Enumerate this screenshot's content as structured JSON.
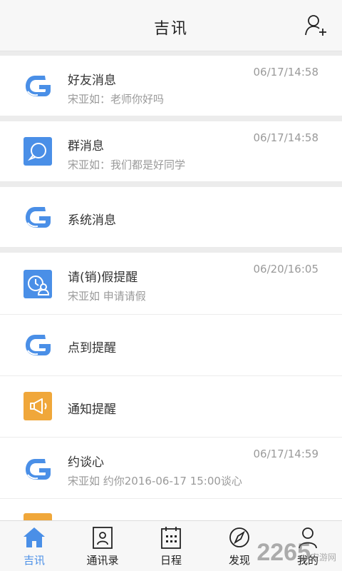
{
  "header": {
    "title": "吉讯",
    "add_icon": "add-contact-icon"
  },
  "items": [
    {
      "name": "好友消息",
      "preview": "宋亚如：老师你好吗",
      "time": "06/17/14:58",
      "icon": "app-logo-icon"
    },
    {
      "name": "群消息",
      "preview": "宋亚如：我们都是好同学",
      "time": "06/17/14:58",
      "icon": "chat-bubble-icon"
    },
    {
      "name": "系统消息",
      "preview": "",
      "time": "",
      "icon": "app-logo-icon"
    },
    {
      "name": "请(销)假提醒",
      "preview": "宋亚如   申请请假",
      "time": "06/20/16:05",
      "icon": "leave-clock-user-icon"
    },
    {
      "name": "点到提醒",
      "preview": "",
      "time": "",
      "icon": "app-logo-icon"
    },
    {
      "name": "通知提醒",
      "preview": "",
      "time": "",
      "icon": "megaphone-icon"
    },
    {
      "name": "约谈心",
      "preview": "宋亚如   约你2016-06-17  15:00谈心",
      "time": "06/17/14:59",
      "icon": "app-logo-icon"
    }
  ],
  "tabs": [
    {
      "label": "吉讯",
      "icon": "home-icon",
      "active": true
    },
    {
      "label": "通讯录",
      "icon": "contacts-icon",
      "active": false
    },
    {
      "label": "日程",
      "icon": "calendar-icon",
      "active": false
    },
    {
      "label": "发现",
      "icon": "compass-icon",
      "active": false
    },
    {
      "label": "我的",
      "icon": "profile-icon",
      "active": false
    }
  ],
  "watermark": {
    "text": "2265",
    "sub": "安游网"
  },
  "colors": {
    "accent": "#4a8fe7",
    "orange": "#f0a73a",
    "header_bg": "#f7f7f7",
    "divider": "#ececec"
  }
}
